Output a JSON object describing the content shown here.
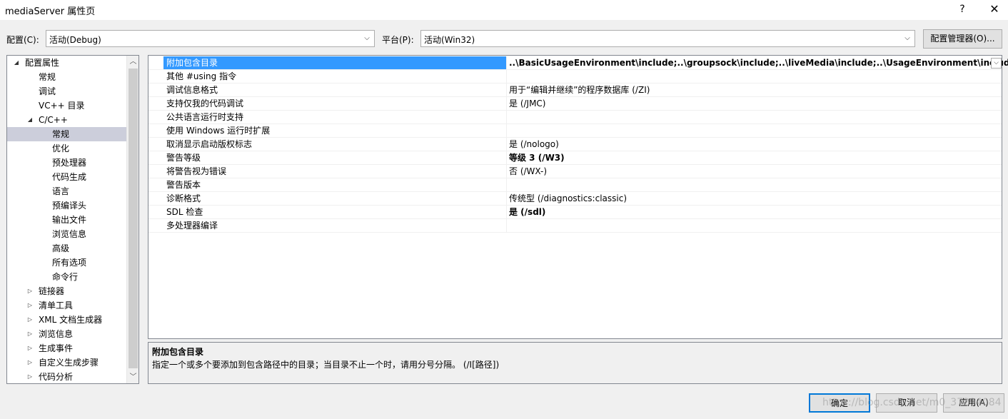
{
  "window": {
    "title": "mediaServer 属性页",
    "help": "?",
    "close": "✕"
  },
  "config": {
    "label": "配置(C):",
    "value": "活动(Debug)",
    "arrow": "⌵"
  },
  "platform": {
    "label": "平台(P):",
    "value": "活动(Win32)",
    "arrow": "⌵"
  },
  "config_manager": "配置管理器(O)...",
  "tree": {
    "items": [
      {
        "label": "配置属性",
        "expander": "◢"
      },
      {
        "label": "常规",
        "expander": ""
      },
      {
        "label": "调试",
        "expander": ""
      },
      {
        "label": "VC++ 目录",
        "expander": ""
      },
      {
        "label": "C/C++",
        "expander": "◢"
      },
      {
        "label": "常规",
        "expander": ""
      },
      {
        "label": "优化",
        "expander": ""
      },
      {
        "label": "预处理器",
        "expander": ""
      },
      {
        "label": "代码生成",
        "expander": ""
      },
      {
        "label": "语言",
        "expander": ""
      },
      {
        "label": "预编译头",
        "expander": ""
      },
      {
        "label": "输出文件",
        "expander": ""
      },
      {
        "label": "浏览信息",
        "expander": ""
      },
      {
        "label": "高级",
        "expander": ""
      },
      {
        "label": "所有选项",
        "expander": ""
      },
      {
        "label": "命令行",
        "expander": ""
      },
      {
        "label": "链接器",
        "expander": "▷"
      },
      {
        "label": "清单工具",
        "expander": "▷"
      },
      {
        "label": "XML 文档生成器",
        "expander": "▷"
      },
      {
        "label": "浏览信息",
        "expander": "▷"
      },
      {
        "label": "生成事件",
        "expander": "▷"
      },
      {
        "label": "自定义生成步骤",
        "expander": "▷"
      },
      {
        "label": "代码分析",
        "expander": "▷"
      }
    ],
    "scroll_up": "︿",
    "scroll_down": "﹀"
  },
  "grid": {
    "dropdown": "⌵",
    "rows": [
      {
        "name": "附加包含目录",
        "value": "..\\BasicUsageEnvironment\\include;..\\groupsock\\include;..\\liveMedia\\include;..\\UsageEnvironment\\include"
      },
      {
        "name": "其他 #using 指令",
        "value": ""
      },
      {
        "name": "调试信息格式",
        "value": "用于“编辑并继续”的程序数据库 (/ZI)"
      },
      {
        "name": "支持仅我的代码调试",
        "value": "是 (/JMC)"
      },
      {
        "name": "公共语言运行时支持",
        "value": ""
      },
      {
        "name": "使用 Windows 运行时扩展",
        "value": ""
      },
      {
        "name": "取消显示启动版权标志",
        "value": "是 (/nologo)"
      },
      {
        "name": "警告等级",
        "value": "等级 3 (/W3)"
      },
      {
        "name": "将警告视为错误",
        "value": "否 (/WX-)"
      },
      {
        "name": "警告版本",
        "value": ""
      },
      {
        "name": "诊断格式",
        "value": "传统型 (/diagnostics:classic)"
      },
      {
        "name": "SDL 检查",
        "value": "是 (/sdl)"
      },
      {
        "name": "多处理器编译",
        "value": ""
      }
    ]
  },
  "description": {
    "title": "附加包含目录",
    "text": "指定一个或多个要添加到包含路径中的目录；当目录不止一个时，请用分号分隔。    (/I[路径])"
  },
  "buttons": {
    "ok": "确定",
    "cancel": "取消",
    "apply": "应用(A)"
  },
  "watermark": "https://blog.csdn.net/m0_37294084"
}
